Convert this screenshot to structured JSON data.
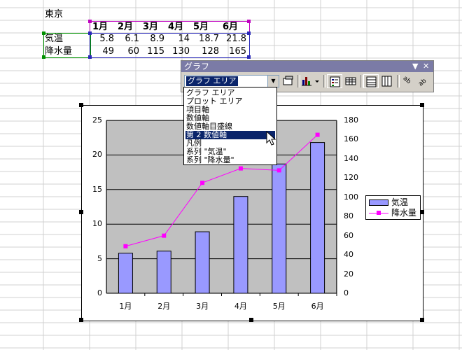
{
  "sheet": {
    "title_cell": "東京",
    "headers": [
      "1月",
      "2月",
      "3月",
      "4月",
      "5月",
      "6月"
    ],
    "rows": [
      {
        "label": "気温",
        "values": [
          "5.8",
          "6.1",
          "8.9",
          "14",
          "18.7",
          "21.8"
        ]
      },
      {
        "label": "降水量",
        "values": [
          "49",
          "60",
          "115",
          "130",
          "128",
          "165"
        ]
      }
    ]
  },
  "toolbar": {
    "title": "グラフ",
    "combo_value": "グラフ エリア",
    "menu_arrow": "▼",
    "close": "✕"
  },
  "dropdown": {
    "items": [
      "グラフ エリア",
      "プロット エリア",
      "項目軸",
      "数値軸",
      "数値軸目盛線",
      "第 2 数値軸",
      "凡例",
      "系列 \"気温\"",
      "系列 \"降水量\""
    ],
    "selected_index": 5
  },
  "chart_data": {
    "type": "bar",
    "categories": [
      "1月",
      "2月",
      "3月",
      "4月",
      "5月",
      "6月"
    ],
    "series": [
      {
        "name": "気温",
        "type": "bar",
        "axis": "primary",
        "values": [
          5.8,
          6.1,
          8.9,
          14,
          18.7,
          21.8
        ],
        "color": "#9999ff"
      },
      {
        "name": "降水量",
        "type": "line",
        "axis": "secondary",
        "values": [
          49,
          60,
          115,
          130,
          128,
          165
        ],
        "color": "#ff00ff"
      }
    ],
    "y_ticks": [
      "0",
      "5",
      "10",
      "15",
      "20",
      "25"
    ],
    "y2_ticks": [
      "0",
      "20",
      "40",
      "60",
      "80",
      "100",
      "120",
      "140",
      "160",
      "180"
    ],
    "ylim": [
      0,
      25
    ],
    "y2lim": [
      0,
      180
    ],
    "legend_position": "right",
    "grid": true
  },
  "colors": {
    "plot_bg": "#c0c0c0",
    "bar": "#9999ff",
    "line": "#ff00ff",
    "selection": "#0a246a"
  }
}
